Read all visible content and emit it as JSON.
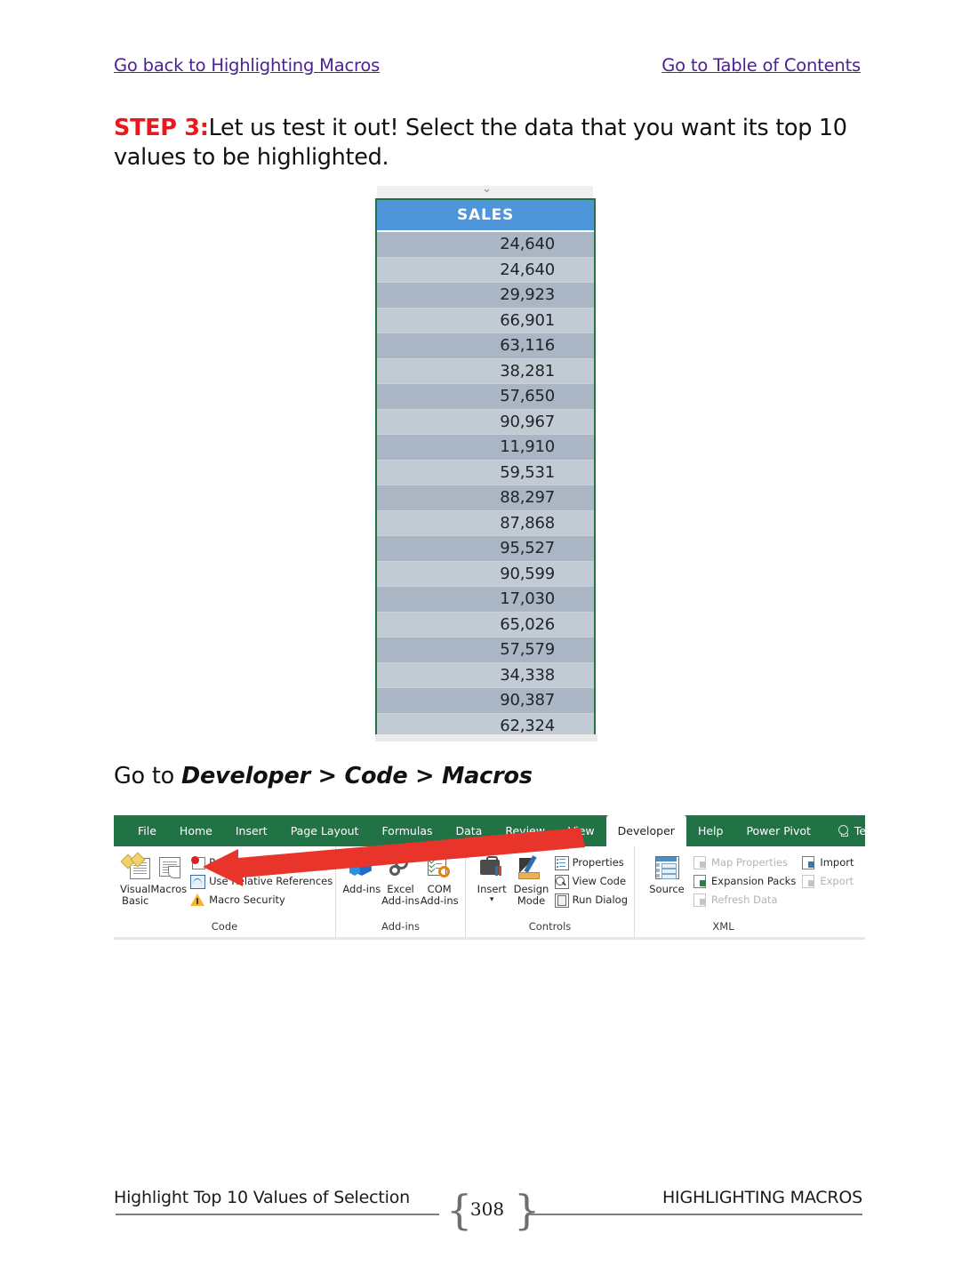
{
  "nav": {
    "back_link": "Go back to Highlighting Macros",
    "toc_link": "Go to Table of Contents"
  },
  "step": {
    "label": "STEP 3:",
    "text": "Let us test it out! Select the data that you want its top 10 values to be highlighted.",
    "label_color": "#e8181c"
  },
  "spreadsheet": {
    "header": "SALES",
    "header_bg": "#4e95d9",
    "header_text_color": "#ffffff",
    "selection_border_color": "#217346",
    "values": [
      "24,640",
      "24,640",
      "29,923",
      "66,901",
      "63,116",
      "38,281",
      "57,650",
      "90,967",
      "11,910",
      "59,531",
      "88,297",
      "87,868",
      "95,527",
      "90,599",
      "17,030",
      "65,026",
      "57,579",
      "34,338",
      "90,387",
      "62,324"
    ]
  },
  "instruction": {
    "prefix": "Go to ",
    "path": "Developer > Code > Macros"
  },
  "ribbon": {
    "tab_bar_color": "#217346",
    "tabs": [
      {
        "label": "File",
        "active": false
      },
      {
        "label": "Home",
        "active": false
      },
      {
        "label": "Insert",
        "active": false
      },
      {
        "label": "Page Layout",
        "active": false
      },
      {
        "label": "Formulas",
        "active": false
      },
      {
        "label": "Data",
        "active": false
      },
      {
        "label": "Review",
        "active": false
      },
      {
        "label": "View",
        "active": false
      },
      {
        "label": "Developer",
        "active": true
      },
      {
        "label": "Help",
        "active": false
      },
      {
        "label": "Power Pivot",
        "active": false
      }
    ],
    "tell_me": "Tell me what yo",
    "groups": [
      {
        "name": "Code",
        "big_buttons": [
          {
            "label": "Visual Basic",
            "icon": "visual-basic-icon"
          },
          {
            "label": "Macros",
            "icon": "macros-icon"
          }
        ],
        "small_buttons": [
          {
            "label": "Record Macro",
            "icon": "record-macro-icon",
            "disabled": false
          },
          {
            "label": "Use Relative References",
            "icon": "relative-references-icon",
            "disabled": false
          },
          {
            "label": "Macro Security",
            "icon": "macro-security-icon",
            "disabled": false
          }
        ]
      },
      {
        "name": "Add-ins",
        "big_buttons": [
          {
            "label": "Add-ins",
            "icon": "add-ins-icon"
          },
          {
            "label": "Excel Add-ins",
            "icon": "excel-add-ins-icon"
          },
          {
            "label": "COM Add-ins",
            "icon": "com-add-ins-icon"
          }
        ],
        "small_buttons": []
      },
      {
        "name": "Controls",
        "big_buttons": [
          {
            "label": "Insert",
            "icon": "insert-control-icon"
          },
          {
            "label": "Design Mode",
            "icon": "design-mode-icon"
          }
        ],
        "small_buttons": [
          {
            "label": "Properties",
            "icon": "properties-icon",
            "disabled": false
          },
          {
            "label": "View Code",
            "icon": "view-code-icon",
            "disabled": false
          },
          {
            "label": "Run Dialog",
            "icon": "run-dialog-icon",
            "disabled": false
          }
        ]
      },
      {
        "name": "XML",
        "big_buttons": [
          {
            "label": "Source",
            "icon": "xml-source-icon"
          }
        ],
        "small_buttons": [
          {
            "label": "Map Properties",
            "icon": "map-properties-icon",
            "disabled": true
          },
          {
            "label": "Expansion Packs",
            "icon": "expansion-packs-icon",
            "disabled": false
          },
          {
            "label": "Refresh Data",
            "icon": "refresh-data-icon",
            "disabled": true
          },
          {
            "label": "Import",
            "icon": "import-icon",
            "disabled": false
          },
          {
            "label": "Export",
            "icon": "export-icon",
            "disabled": true
          }
        ]
      }
    ],
    "annotation_arrow_color": "#e8342a"
  },
  "footer": {
    "left": "Highlight Top 10 Values of Selection",
    "page_number": "308",
    "right": "HIGHLIGHTING MACROS"
  }
}
